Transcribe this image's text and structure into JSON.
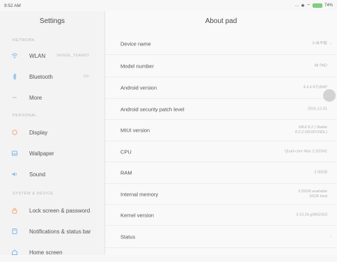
{
  "status": {
    "time": "9:52 AM",
    "battery": "74%"
  },
  "sidebar": {
    "title": "Settings",
    "sections": {
      "network": "NETWORK",
      "personal": "PERSONAL",
      "system": "SYSTEM & DEVICE"
    },
    "items": [
      {
        "label": "WLAN",
        "value": "SENSE_TEAM03",
        "icon": "wifi-icon"
      },
      {
        "label": "Bluetooth",
        "value": "On",
        "icon": "bluetooth-icon"
      },
      {
        "label": "More",
        "value": "",
        "icon": "more-icon"
      },
      {
        "label": "Display",
        "value": "",
        "icon": "display-icon"
      },
      {
        "label": "Wallpaper",
        "value": "",
        "icon": "wallpaper-icon"
      },
      {
        "label": "Sound",
        "value": "",
        "icon": "sound-icon"
      },
      {
        "label": "Lock screen & password",
        "value": "",
        "icon": "lock-icon"
      },
      {
        "label": "Notifications & status bar",
        "value": "",
        "icon": "notification-icon"
      },
      {
        "label": "Home screen",
        "value": "",
        "icon": "home-icon"
      }
    ],
    "colors": {
      "accent": "#f5a77a",
      "blue": "#7fb6e8"
    }
  },
  "main": {
    "title": "About pad",
    "rows": [
      {
        "key": "Device name",
        "value": "小米平板"
      },
      {
        "key": "Model number",
        "value": "MI PAD"
      },
      {
        "key": "Android version",
        "value": "4.4.4 KTU84P"
      },
      {
        "key": "Android security patch level",
        "value": "2016-12-01"
      },
      {
        "key": "MIUI version",
        "value": "MIUI 8.2 | Stable",
        "value2": "8.2.2.0(KXFCNDL)"
      },
      {
        "key": "CPU",
        "value": "Quad-core Max 2.32GHz"
      },
      {
        "key": "RAM",
        "value": "2.00GB"
      },
      {
        "key": "Internal memory",
        "value": "3.55GB available",
        "value2": "16GB total"
      },
      {
        "key": "Kernel version",
        "value": "3.10.24-g9862423"
      },
      {
        "key": "Status",
        "value": ""
      }
    ]
  }
}
